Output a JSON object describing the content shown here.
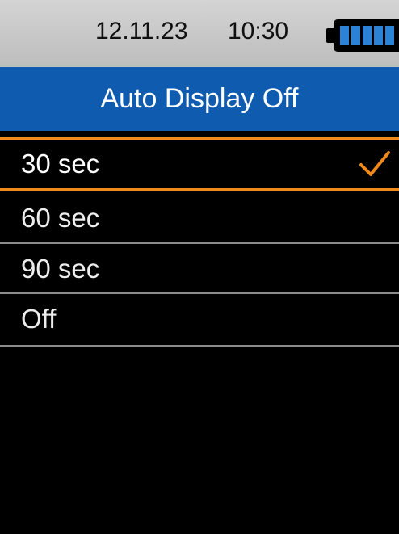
{
  "status": {
    "date": "12.11.23",
    "time": "10:30",
    "battery_level": 1.0
  },
  "title": "Auto Display Off",
  "options": [
    {
      "label": "30 sec",
      "selected": true
    },
    {
      "label": "60 sec",
      "selected": false
    },
    {
      "label": "90 sec",
      "selected": false
    },
    {
      "label": "Off",
      "selected": false
    }
  ],
  "colors": {
    "accent": "#f08a1a",
    "header": "#0f5bb0",
    "status_bar": "#c8c8c8",
    "battery": "#2a83d6",
    "background": "#000000"
  },
  "icons": {
    "battery": "battery-full-icon",
    "check": "checkmark-icon"
  }
}
